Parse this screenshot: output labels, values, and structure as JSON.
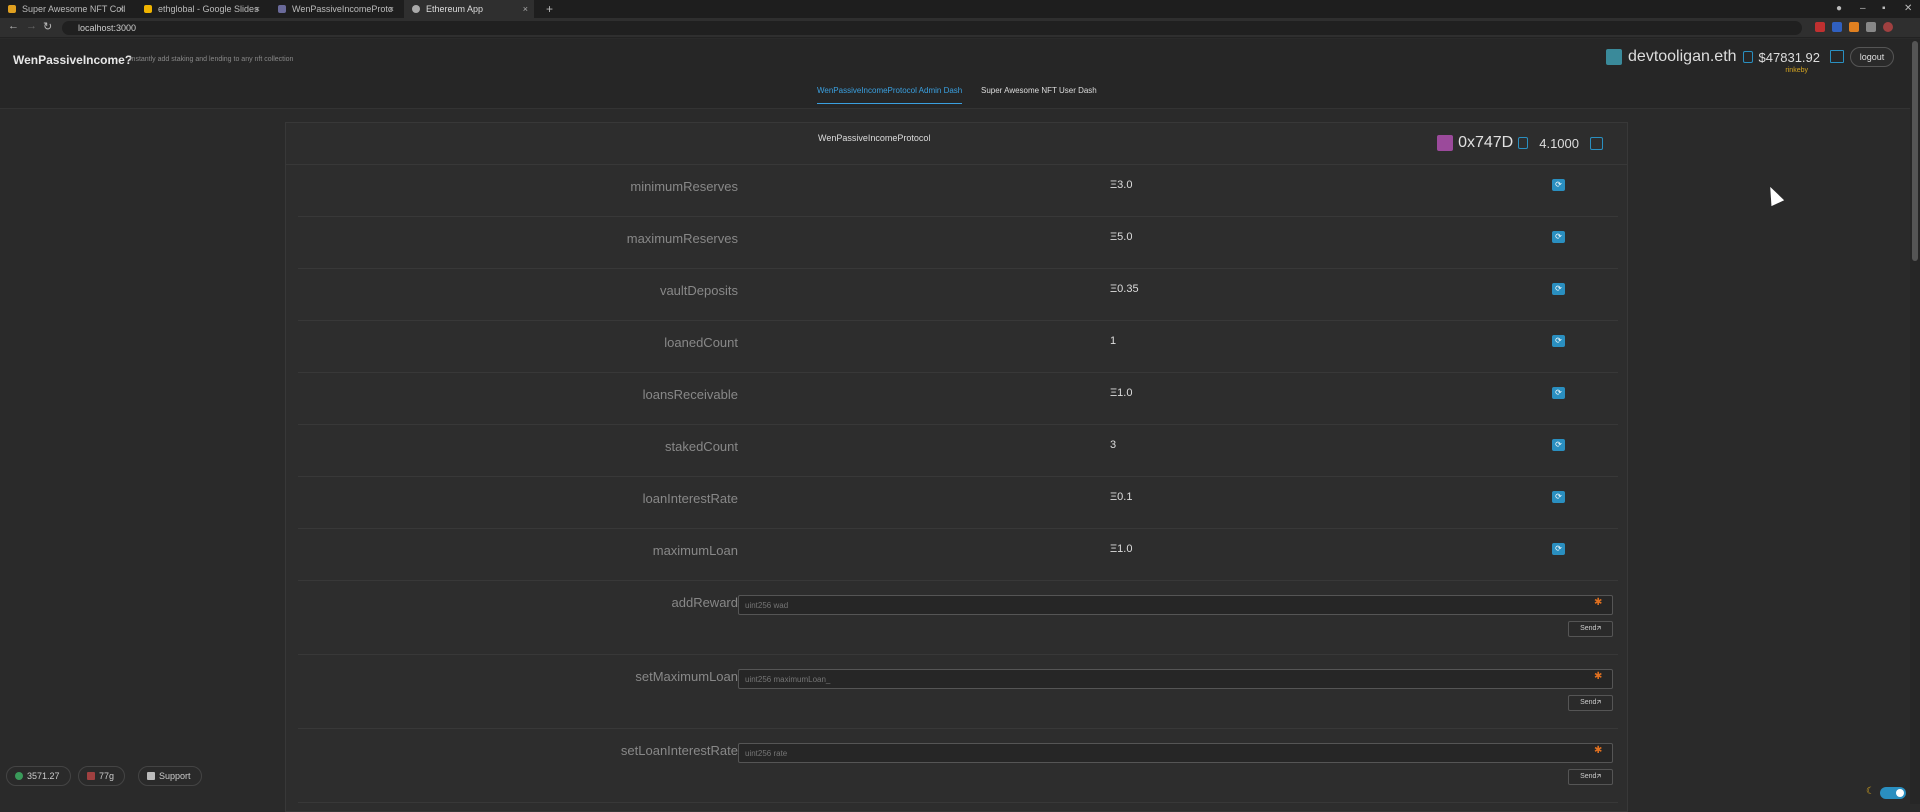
{
  "browser": {
    "tabs": [
      {
        "title": "Super Awesome NFT Coll",
        "color": "#e0a020"
      },
      {
        "title": "ethglobal - Google Slides",
        "color": "#f0b400"
      },
      {
        "title": "WenPassiveIncomeProto",
        "color": "#6a6a9a"
      },
      {
        "title": "Ethereum App",
        "color": "#aaaaaa"
      }
    ],
    "url": "localhost:3000",
    "new_tab": "+",
    "close": "×"
  },
  "header": {
    "brand": "WenPassiveIncome?",
    "tagline": "instantly add staking and lending to any nft collection",
    "ens": "devtooligan.eth",
    "balance": "$47831.92",
    "network": "rinkeby",
    "logout": "logout"
  },
  "nav": {
    "items": [
      "WenPassiveIncomeProtocol Admin Dash",
      "Super Awesome NFT User Dash"
    ]
  },
  "contract": {
    "name": "WenPassiveIncomeProtocol",
    "address": "0x747D",
    "eth_balance": "4.1000"
  },
  "reads": [
    {
      "label": "minimumReserves",
      "value": "Ξ3.0"
    },
    {
      "label": "maximumReserves",
      "value": "Ξ5.0"
    },
    {
      "label": "vaultDeposits",
      "value": "Ξ0.35"
    },
    {
      "label": "loanedCount",
      "value": "1"
    },
    {
      "label": "loansReceivable",
      "value": "Ξ1.0"
    },
    {
      "label": "stakedCount",
      "value": "3"
    },
    {
      "label": "loanInterestRate",
      "value": "Ξ0.1"
    },
    {
      "label": "maximumLoan",
      "value": "Ξ1.0"
    }
  ],
  "writes": [
    {
      "label": "addReward",
      "placeholder": "uint256 wad",
      "send": "Send🡭"
    },
    {
      "label": "setMaximumLoan",
      "placeholder": "uint256 maximumLoan_",
      "send": "Send🡭"
    },
    {
      "label": "setLoanInterestRate",
      "placeholder": "uint256 rate",
      "send": "Send🡭"
    }
  ],
  "footer": {
    "eth_price": "3571.27",
    "gas": "77g",
    "support": "Support"
  },
  "colors": {
    "accent": "#3aa0e0",
    "warning": "#e07020"
  }
}
